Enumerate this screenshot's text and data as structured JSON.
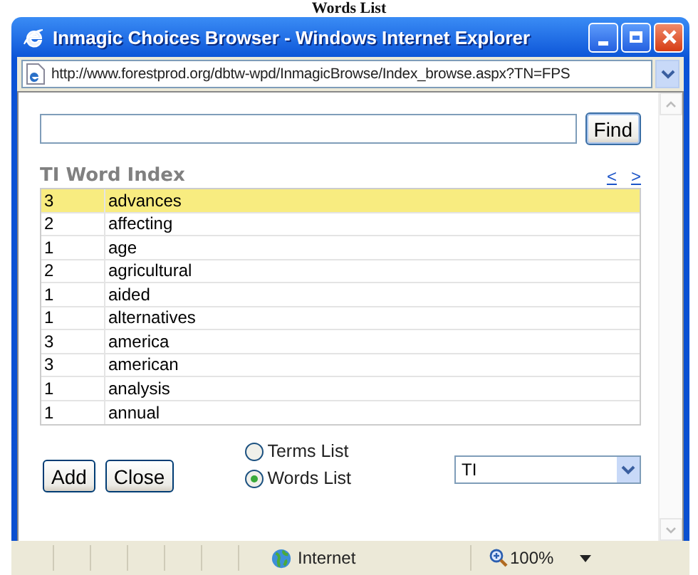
{
  "page_heading": "Words List",
  "window": {
    "title": "Inmagic Choices Browser - Windows Internet Explorer",
    "address": "http://www.forestprod.org/dbtw-wpd/InmagicBrowse/Index_browse.aspx?TN=FPS"
  },
  "find_button": "Find",
  "index": {
    "title": "TI Word Index",
    "prev": "<",
    "next": ">",
    "rows": [
      {
        "count": "3",
        "term": "advances",
        "selected": true
      },
      {
        "count": "2",
        "term": "affecting",
        "selected": false
      },
      {
        "count": "1",
        "term": "age",
        "selected": false
      },
      {
        "count": "2",
        "term": "agricultural",
        "selected": false
      },
      {
        "count": "1",
        "term": "aided",
        "selected": false
      },
      {
        "count": "1",
        "term": "alternatives",
        "selected": false
      },
      {
        "count": "3",
        "term": "america",
        "selected": false
      },
      {
        "count": "3",
        "term": "american",
        "selected": false
      },
      {
        "count": "1",
        "term": "analysis",
        "selected": false
      },
      {
        "count": "1",
        "term": "annual",
        "selected": false
      }
    ]
  },
  "buttons": [
    "Add",
    "Close"
  ],
  "list_type": [
    {
      "label": "Terms List",
      "selected": false
    },
    {
      "label": "Words List",
      "selected": true
    }
  ],
  "field_select": {
    "value": "TI"
  },
  "status_bar": {
    "zone": "Internet",
    "zoom": "100%"
  }
}
